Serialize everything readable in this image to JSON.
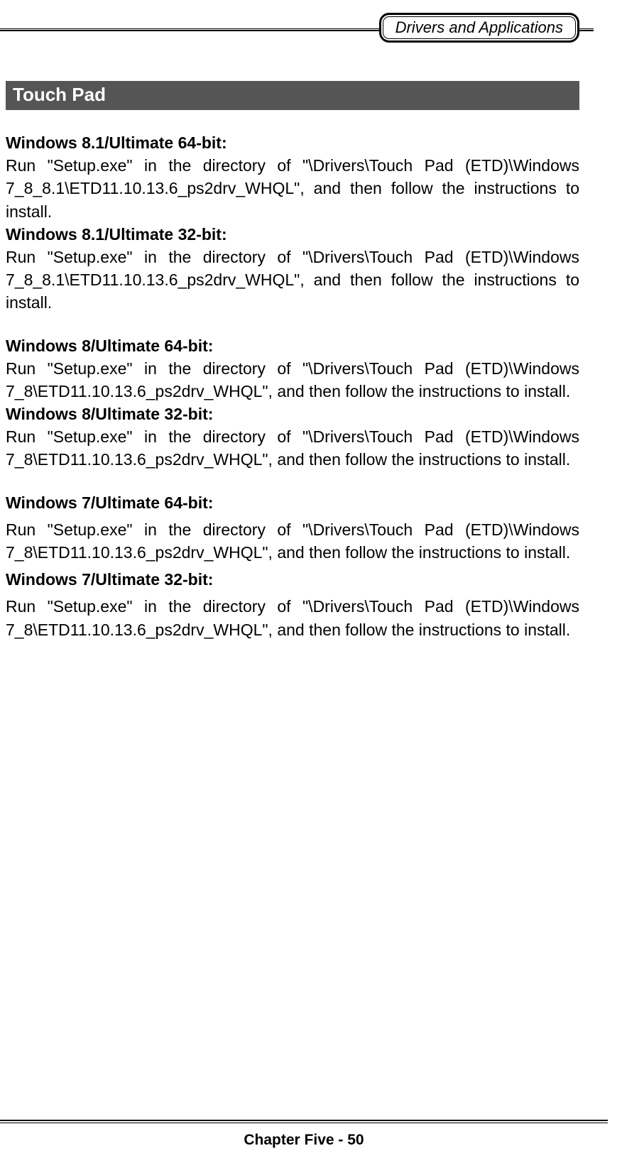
{
  "header": {
    "badge": "Drivers and Applications"
  },
  "section": {
    "title": "Touch Pad"
  },
  "items": [
    {
      "label": "Windows 8.1/Ultimate 64-bit:",
      "text": "Run \"Setup.exe\" in the directory of \"\\Drivers\\Touch Pad (ETD)\\Windows 7_8_8.1\\ETD11.10.13.6_ps2drv_WHQL\", and then follow the instructions to install."
    },
    {
      "label": "Windows 8.1/Ultimate 32-bit:",
      "text": "Run \"Setup.exe\" in the directory of \"\\Drivers\\Touch Pad (ETD)\\Windows 7_8_8.1\\ETD11.10.13.6_ps2drv_WHQL\", and then follow the instructions to install."
    },
    {
      "label": "Windows 8/Ultimate 64-bit:",
      "text": "Run \"Setup.exe\" in the directory of \"\\Drivers\\Touch Pad (ETD)\\Windows 7_8\\ETD11.10.13.6_ps2drv_WHQL\", and then follow the instructions to install."
    },
    {
      "label": "Windows 8/Ultimate 32-bit:",
      "text": "Run \"Setup.exe\" in the directory of \"\\Drivers\\Touch Pad (ETD)\\Windows 7_8\\ETD11.10.13.6_ps2drv_WHQL\", and then follow the instructions to install."
    },
    {
      "label": "Windows 7/Ultimate 64-bit:",
      "text": "Run \"Setup.exe\" in the directory of \"\\Drivers\\Touch Pad (ETD)\\Windows 7_8\\ETD11.10.13.6_ps2drv_WHQL\", and then follow the instructions to install."
    },
    {
      "label": "Windows 7/Ultimate 32-bit:",
      "text": "Run \"Setup.exe\" in the directory of \"\\Drivers\\Touch Pad (ETD)\\Windows 7_8\\ETD11.10.13.6_ps2drv_WHQL\", and then follow the instructions to install."
    }
  ],
  "footer": {
    "text": "Chapter Five - 50"
  }
}
